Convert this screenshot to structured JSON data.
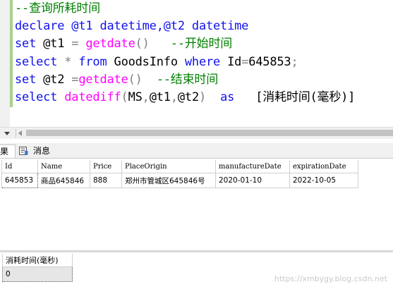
{
  "editor": {
    "lines": [
      [
        {
          "t": "--查询所耗时间",
          "c": "cm"
        }
      ],
      [
        {
          "t": "declare",
          "c": "kw"
        },
        {
          "t": " @t1 ",
          "c": "kw"
        },
        {
          "t": "datetime",
          "c": "kw"
        },
        {
          "t": ",@t2 ",
          "c": "kw"
        },
        {
          "t": "datetime",
          "c": "kw"
        }
      ],
      [
        {
          "t": "set",
          "c": "kw"
        },
        {
          "t": " @t1 ",
          "c": "tx"
        },
        {
          "t": "=",
          "c": "gy"
        },
        {
          "t": " getdate",
          "c": "fn"
        },
        {
          "t": "()",
          "c": "gy"
        },
        {
          "t": "   --开始时间",
          "c": "cm"
        }
      ],
      [
        {
          "t": "select",
          "c": "kw"
        },
        {
          "t": " ",
          "c": "tx"
        },
        {
          "t": "*",
          "c": "gy"
        },
        {
          "t": " from",
          "c": "kw"
        },
        {
          "t": " GoodsInfo ",
          "c": "tx"
        },
        {
          "t": "where",
          "c": "kw"
        },
        {
          "t": " Id",
          "c": "tx"
        },
        {
          "t": "=",
          "c": "gy"
        },
        {
          "t": "645853",
          "c": "tx"
        },
        {
          "t": ";",
          "c": "gy"
        }
      ],
      [
        {
          "t": "set",
          "c": "kw"
        },
        {
          "t": " @t2 ",
          "c": "tx"
        },
        {
          "t": "=",
          "c": "gy"
        },
        {
          "t": "getdate",
          "c": "fn"
        },
        {
          "t": "()",
          "c": "gy"
        },
        {
          "t": "  --结束时间",
          "c": "cm"
        }
      ],
      [
        {
          "t": "select",
          "c": "kw"
        },
        {
          "t": " datediff",
          "c": "fn"
        },
        {
          "t": "(",
          "c": "gy"
        },
        {
          "t": "MS",
          "c": "tx"
        },
        {
          "t": ",",
          "c": "gy"
        },
        {
          "t": "@t1",
          "c": "tx"
        },
        {
          "t": ",",
          "c": "gy"
        },
        {
          "t": "@t2",
          "c": "tx"
        },
        {
          "t": ")",
          "c": "gy"
        },
        {
          "t": "  as",
          "c": "kw"
        },
        {
          "t": "   [消耗时间(毫秒)]",
          "c": "tx"
        }
      ]
    ]
  },
  "tabs": {
    "results_label": "果",
    "messages_label": "消息"
  },
  "results": {
    "columns": [
      "Id",
      "Name",
      "Price",
      "PlaceOrigin",
      "manufactureDate",
      "expirationDate"
    ],
    "rows": [
      [
        "645853",
        "商品645846",
        "888",
        "郑州市管城区645846号",
        "2020-01-10",
        "2022-10-05"
      ]
    ]
  },
  "results2": {
    "columns": [
      "消耗时间(毫秒)"
    ],
    "rows": [
      [
        "0"
      ]
    ]
  },
  "watermark": "https://xmbygy.blog.csdn.net"
}
